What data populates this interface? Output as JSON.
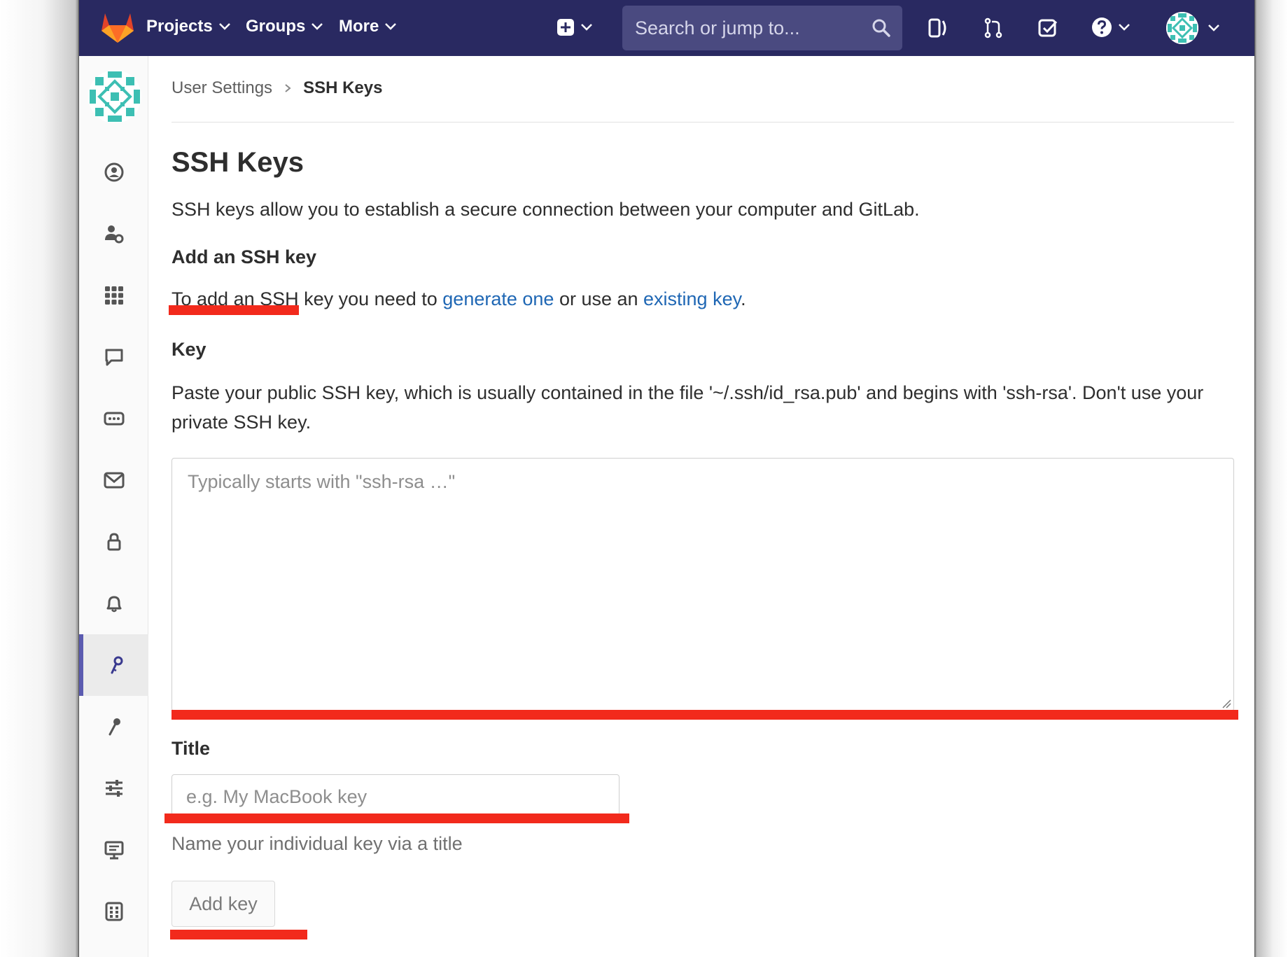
{
  "navbar": {
    "projects_label": "Projects",
    "groups_label": "Groups",
    "more_label": "More",
    "search_placeholder": "Search or jump to..."
  },
  "breadcrumb": {
    "parent": "User Settings",
    "current": "SSH Keys"
  },
  "page": {
    "title": "SSH Keys",
    "intro": "SSH keys allow you to establish a secure connection between your computer and GitLab.",
    "add_heading": "Add an SSH key",
    "add_text_before": "To add an SSH key you need to",
    "generate_link": "generate one",
    "add_text_middle": "or use an",
    "existing_link": "existing key",
    "add_text_end": ".",
    "key_label": "Key",
    "key_help": "Paste your public SSH key, which is usually contained in the file '~/.ssh/id_rsa.pub' and begins with 'ssh-rsa'. Don't use your private SSH key.",
    "key_placeholder": "Typically starts with \"ssh-rsa …\"",
    "title_label": "Title",
    "title_placeholder": "e.g. My MacBook key",
    "title_help": "Name your individual key via a title",
    "add_button": "Add key"
  },
  "sidebar": {
    "items": [
      {
        "icon": "profile-icon"
      },
      {
        "icon": "account-icon"
      },
      {
        "icon": "applications-icon"
      },
      {
        "icon": "chat-icon"
      },
      {
        "icon": "access-tokens-icon"
      },
      {
        "icon": "emails-icon"
      },
      {
        "icon": "password-icon"
      },
      {
        "icon": "notifications-icon"
      },
      {
        "icon": "ssh-keys-icon",
        "active": true
      },
      {
        "icon": "gpg-keys-icon"
      },
      {
        "icon": "preferences-icon"
      },
      {
        "icon": "active-sessions-icon"
      },
      {
        "icon": "audit-log-icon"
      }
    ]
  },
  "colors": {
    "navbar": "#292961",
    "link": "#1f67b4",
    "annotation": "#f22a1c",
    "active_sidebar": "#5b5bb0"
  }
}
